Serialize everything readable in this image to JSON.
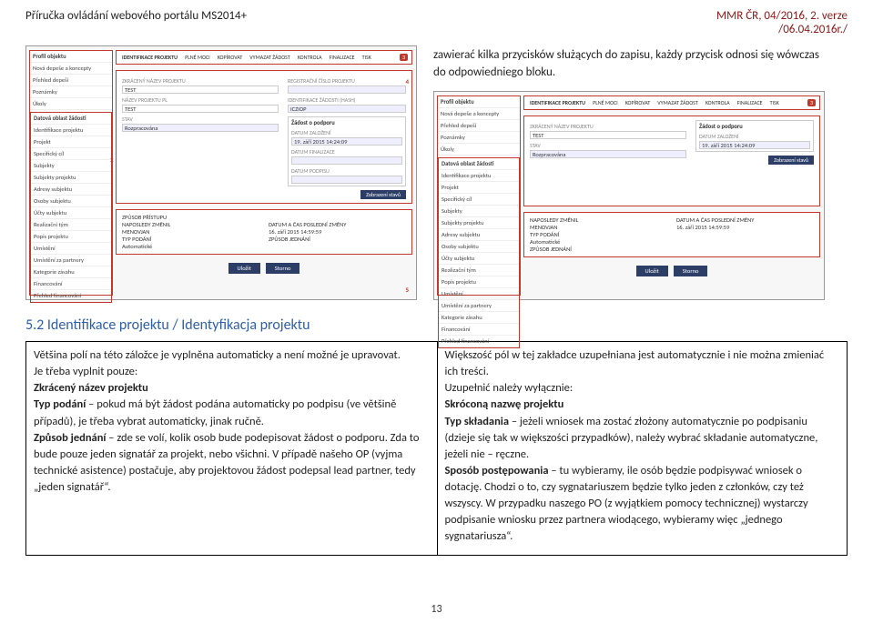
{
  "header": {
    "left": "Příručka ovládání webového portálu MS2014+",
    "right_line1": "MMR ČR, 04/2016, 2. verze",
    "right_line2": "/06.04.2016r./"
  },
  "intro_right": "zawierać kilka przycisków służących do zapisu, każdy przycisk odnosi się wówczas do odpowiedniego bloku.",
  "section_title": "5.2 Identifikace projektu / Identyfikacja projektu",
  "shot": {
    "side_top": "Profil objektu",
    "side_items_a": [
      "Nová depeše a koncepty",
      "Přehled depeší",
      "Poznámky",
      "Úkoly"
    ],
    "side_grp_hdr": "Datová oblast žádosti",
    "side_items_b": [
      "Identifikace projektu",
      "Projekt",
      "Specifický cíl",
      "Subjekty",
      "Subjekty projektu",
      "Adresy subjektu",
      "Osoby subjektu",
      "Účty subjektu",
      "Realizační tým",
      "Popis projektu",
      "Umístění",
      "Umístění za partnery",
      "Kategorie zásahu",
      "Financování",
      "Přehled financování"
    ],
    "tab_first": "IDENTIFIKACE PROJEKTU",
    "tabs": [
      "PLNÉ MOCI",
      "KOPÍROVAT",
      "VYMAZAT ŽÁDOST",
      "KONTROLA",
      "FINALIZACE",
      "TISK"
    ],
    "badge3": "3",
    "badge4": "4",
    "badge2": "2",
    "badge5": "5",
    "hdr_bar": "ZKRÁCENÝ NÁZEV PROJEKTU",
    "fld_test": "TEST",
    "fld_nazev_lbl": "NÁZEV PROJEKTU PL",
    "fld_test2": "TEST",
    "fld_stav": "STAV",
    "fld_stav_v": "Rozpracována",
    "colR_hdr1": "REGISTRAČNÍ ČÍSLO PROJEKTU",
    "colR_hdr2": "IDENTIFIKACE ŽÁDOSTI (HASH)",
    "colR_box": "Žádost o podporu",
    "colR_date1": "19. září 2015 14:24:09",
    "colR_date_lbl1": "DATUM ZALOŽENÍ",
    "colR_date_lbl2": "DATUM FINALIZACE",
    "colR_date_lbl3": "DATUM PODPISU",
    "btn_zobrazit": "Zobrazení stavů",
    "below_lbl1": "ZPŮSOB PŘÍSTUPU",
    "below_lbl2": "NAPOSLEDY ZMĚNIL",
    "below_val2": "MENOVJAN",
    "below_lbl3": "DATUM A ČAS POSLEDNÍ ZMĚNY",
    "below_val3": "16. září 2015 14:59:59",
    "below_lbl4": "TYP PODÁNÍ",
    "below_val4": "Automatické",
    "below_lbl5": "ZPŮSOB JEDNÁNÍ",
    "btn_ulozit": "Uložit",
    "btn_storno": "Storno"
  },
  "col_left": {
    "p1": "Většina polí na této záložce je vyplněna automaticky a není možné je upravovat.",
    "p2a": "Je třeba vyplnit pouze:",
    "p2b": "Zkrácený název projektu",
    "p3a": "Typ podání",
    "p3b": " – pokud má být žádost podána automaticky po podpisu (ve většině případů), je třeba vybrat automaticky, jinak ručně.",
    "p4a": "Způsob jednání",
    "p4b": " – zde se volí, kolik osob bude podepisovat žádost o podporu. Zda to bude pouze jeden signatář za projekt, nebo všichni. V případě našeho OP (vyjma technické asistence) postačuje, aby projektovou žádost podepsal lead partner, tedy „jeden signatář“."
  },
  "col_right": {
    "p1": "Większość pól w tej zakładce uzupełniana jest automatycznie i nie można zmieniać ich treści.",
    "p2a": "Uzupełnić należy wyłącznie:",
    "p2b": "Skróconą nazwę projektu",
    "p3a": "Typ składania",
    "p3b": " – jeżeli wniosek ma zostać złożony automatycznie po podpisaniu (dzieje się tak w większości przypadków), należy wybrać składanie automatyczne, jeżeli nie – ręczne.",
    "p4a": "Sposób postępowania",
    "p4b": " – tu wybieramy, ile osób będzie podpisywać wniosek o dotację. Chodzi o to, czy sygnatariuszem będzie tylko jeden z członków, czy też wszyscy. W przypadku naszego PO (z wyjątkiem pomocy technicznej) wystarczy podpisanie wniosku przez partnera wiodącego, wybieramy więc „jednego sygnatariusza“."
  },
  "page_num": "13"
}
